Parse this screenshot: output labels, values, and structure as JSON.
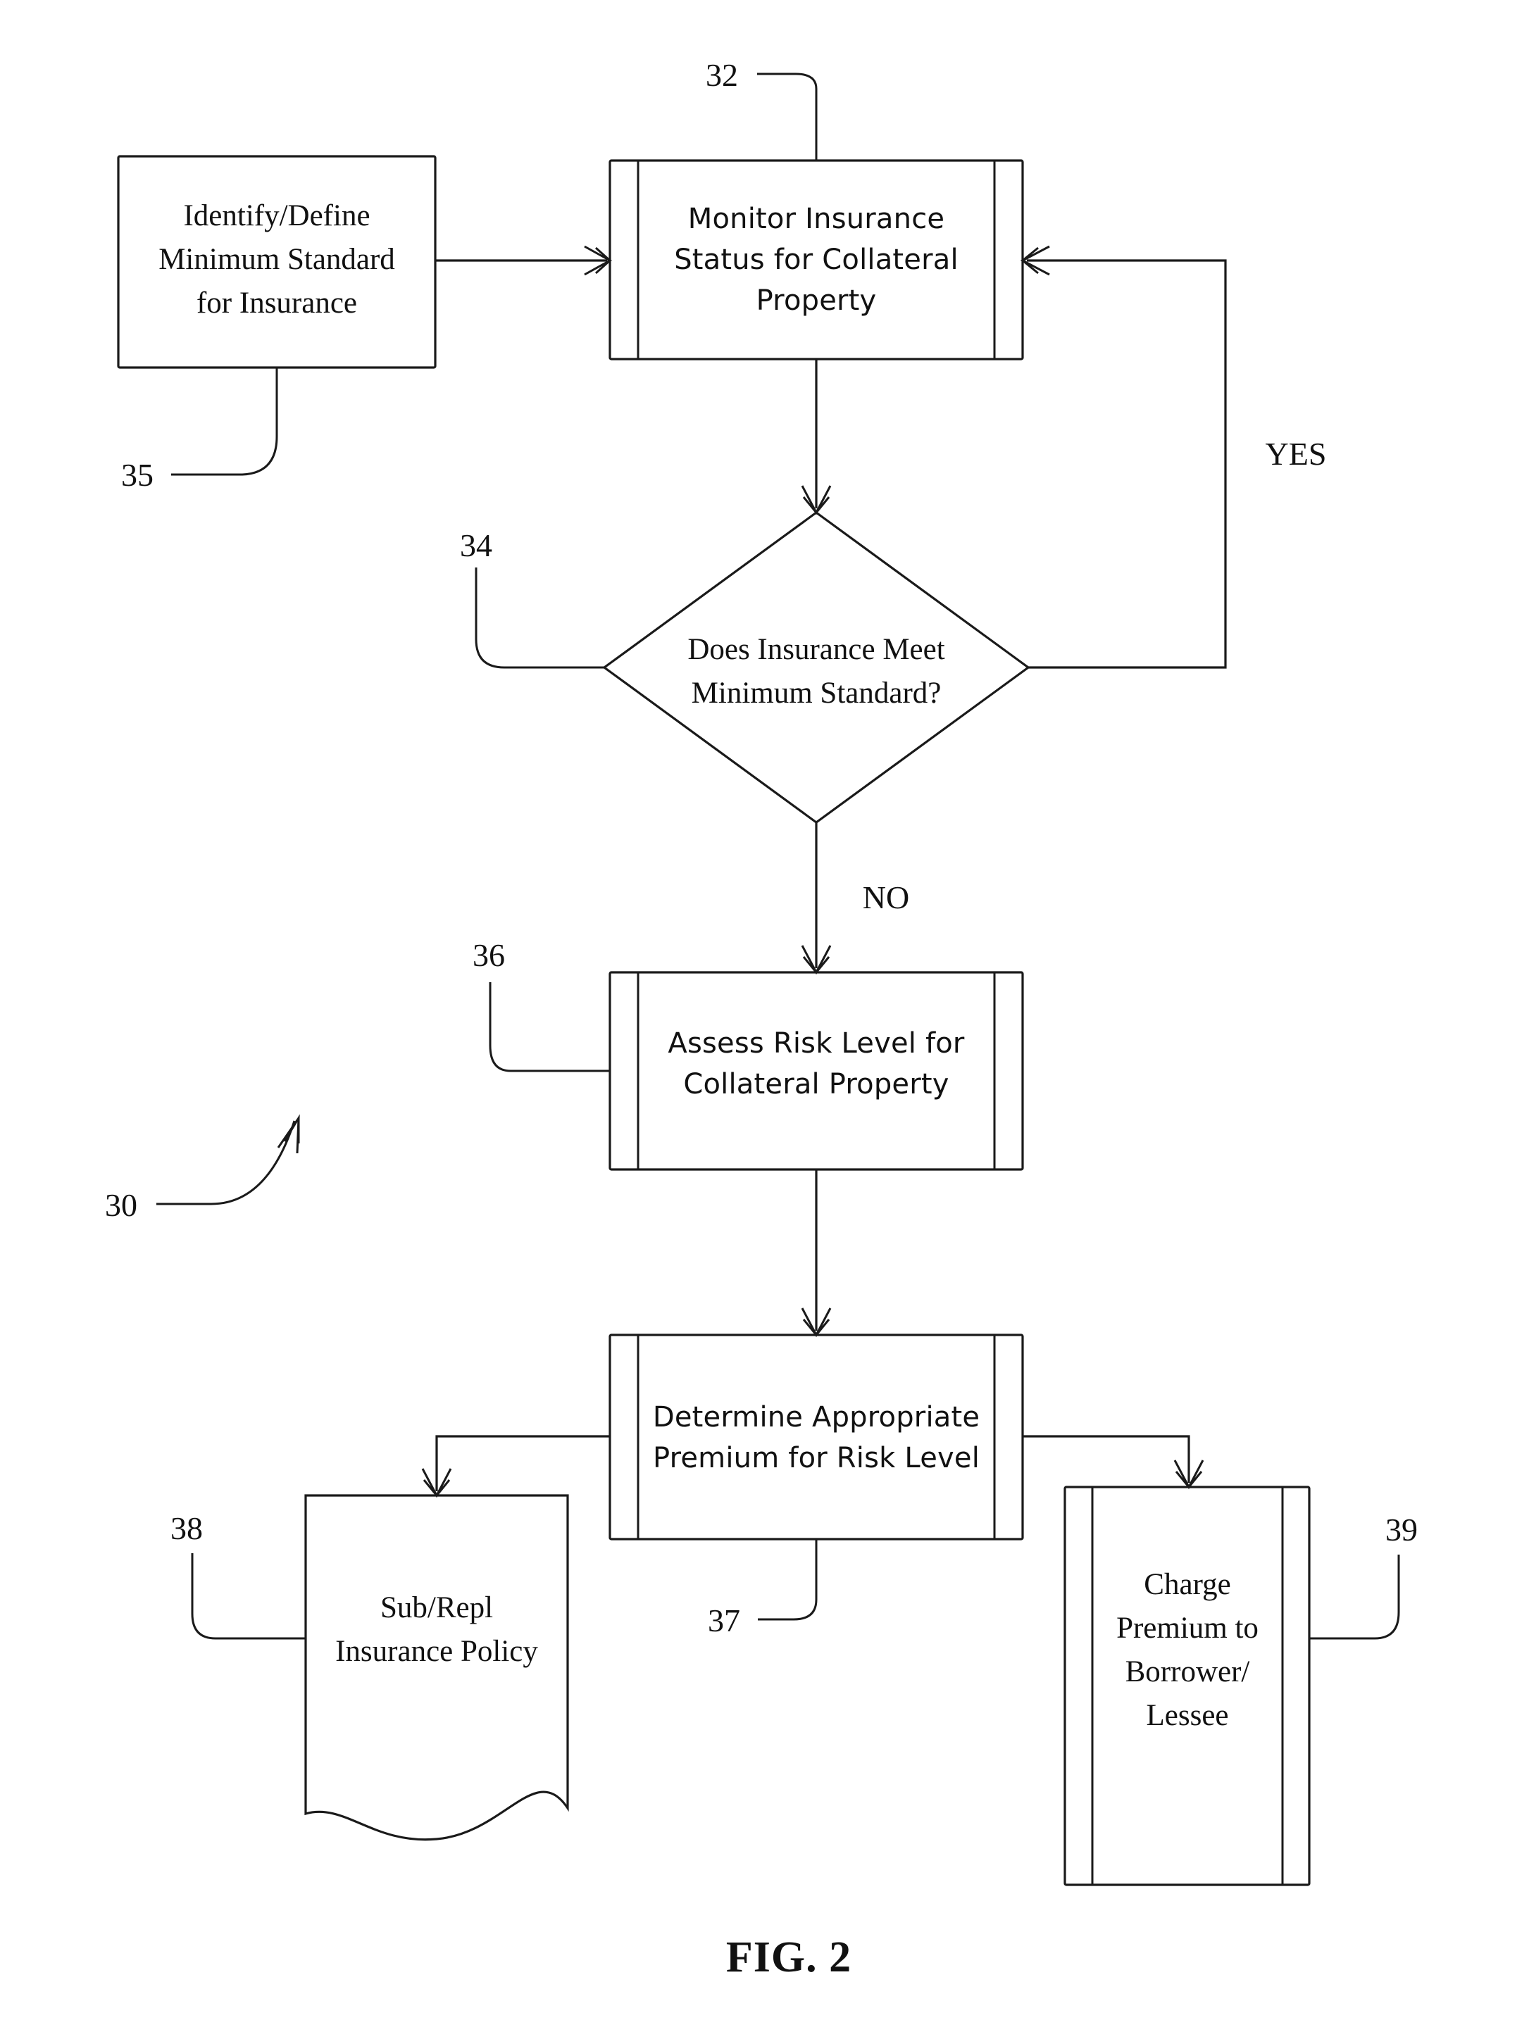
{
  "figure": {
    "caption": "FIG. 2",
    "overall_ref": "30"
  },
  "nodes": [
    {
      "id": "identify-define",
      "ref": "35",
      "shape": "process",
      "font": "serif",
      "lines": [
        "Identify/Define",
        "Minimum Standard",
        "for Insurance"
      ]
    },
    {
      "id": "monitor-insurance",
      "ref": "32",
      "shape": "predefined-process",
      "font": "sans",
      "lines": [
        "Monitor Insurance",
        "Status for Collateral",
        "Property"
      ]
    },
    {
      "id": "insurance-decision",
      "ref": "34",
      "shape": "decision",
      "font": "serif",
      "lines": [
        "Does Insurance Meet",
        "Minimum Standard?"
      ]
    },
    {
      "id": "assess-risk",
      "ref": "36",
      "shape": "predefined-process",
      "font": "sans",
      "lines": [
        "Assess Risk Level for",
        "Collateral Property"
      ]
    },
    {
      "id": "determine-premium",
      "ref": "37",
      "shape": "predefined-process",
      "font": "sans",
      "lines": [
        "Determine Appropriate",
        "Premium for Risk Level"
      ]
    },
    {
      "id": "sub-repl-policy",
      "ref": "38",
      "shape": "document",
      "font": "serif",
      "lines": [
        "Sub/Repl",
        "Insurance Policy"
      ]
    },
    {
      "id": "charge-premium",
      "ref": "39",
      "shape": "predefined-process",
      "font": "serif",
      "lines": [
        "Charge",
        "Premium to",
        "Borrower/",
        "Lessee"
      ]
    }
  ],
  "branch_labels": {
    "yes": "YES",
    "no": "NO"
  },
  "reference_numerals": {
    "n30": "30",
    "n32": "32",
    "n34": "34",
    "n35": "35",
    "n36": "36",
    "n37": "37",
    "n38": "38",
    "n39": "39"
  },
  "colors": {
    "ink": "#1a1a1a",
    "paper": "#ffffff"
  }
}
